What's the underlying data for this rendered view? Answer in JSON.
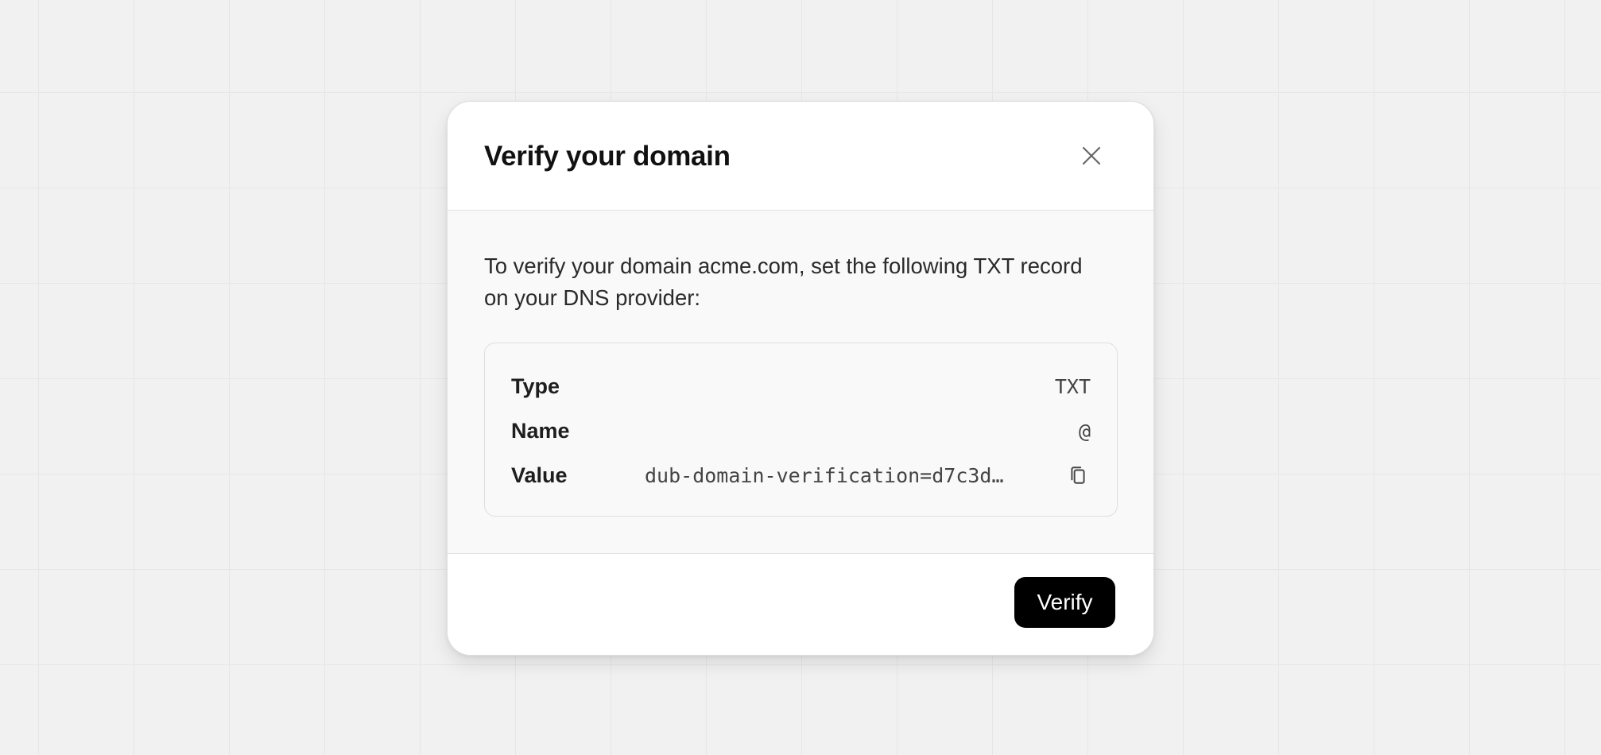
{
  "modal": {
    "title": "Verify your domain",
    "instructions": "To verify your domain acme.com, set the following TXT record on your DNS provider:",
    "records": [
      {
        "label": "Type",
        "value": "TXT"
      },
      {
        "label": "Name",
        "value": "@"
      },
      {
        "label": "Value",
        "value": "dub-domain-verification=d7c3d…"
      }
    ],
    "verify_label": "Verify",
    "icons": {
      "close": "close-icon",
      "copy": "copy-icon"
    }
  }
}
